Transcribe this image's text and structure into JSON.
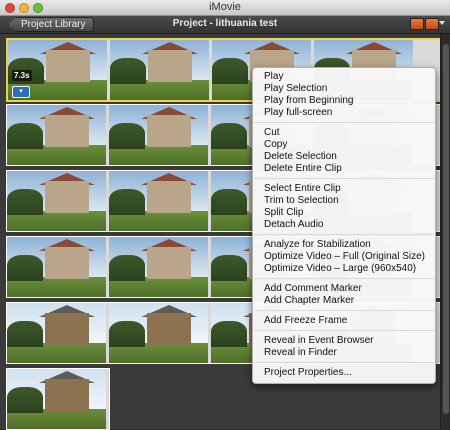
{
  "app": {
    "title": "iMovie"
  },
  "toolbar": {
    "library_label": "Project Library",
    "project_title": "Project - lithuania test"
  },
  "clip": {
    "duration": "7.3s",
    "badge_icon": "clip-settings-icon"
  },
  "menu": {
    "groups": [
      [
        "Play",
        "Play Selection",
        "Play from Beginning",
        "Play full-screen"
      ],
      [
        "Cut",
        "Copy",
        "Delete Selection",
        "Delete Entire Clip"
      ],
      [
        "Select Entire Clip",
        "Trim to Selection",
        "Split Clip",
        "Detach Audio"
      ],
      [
        "Analyze for Stabilization",
        "Optimize Video – Full (Original Size)",
        "Optimize Video – Large (960x540)"
      ],
      [
        "Add Comment Marker",
        "Add Chapter Marker"
      ],
      [
        "Add Freeze Frame"
      ],
      [
        "Reveal in Event Browser",
        "Reveal in Finder"
      ],
      [
        "Project Properties..."
      ]
    ]
  },
  "colors": {
    "selection": "#e8d34a",
    "menu_bg": "#f8f8f8",
    "accent": "#2c6fb9"
  }
}
